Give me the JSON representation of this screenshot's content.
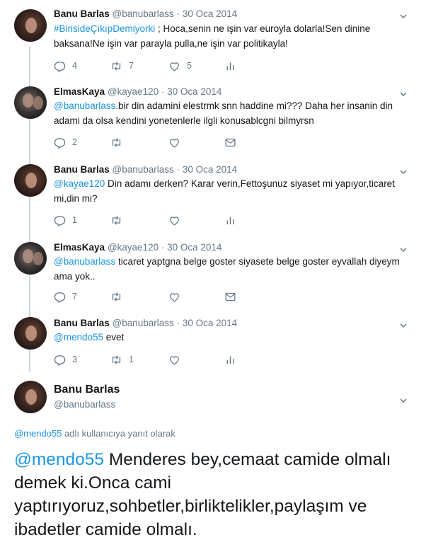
{
  "tweets": [
    {
      "name": "Banu Barlas",
      "handle": "@banubarlass",
      "date": "30 Oca 2014",
      "text_parts": [
        {
          "text": "#BirisideÇıkıpDemiyorki",
          "link": true
        },
        {
          "text": " ; Hoca,senin ne işin var euroyla dolarla!Sen dinine baksana!Ne işin var parayla pulla,ne işin var politikayla!",
          "link": false
        }
      ],
      "reply_count": "4",
      "retweet_count": "7",
      "like_count": "5",
      "last_icon": "analytics-icon"
    },
    {
      "name": "ElmasKaya",
      "handle": "@kayae120",
      "date": "30 Oca 2014",
      "text_parts": [
        {
          "text": "@banubarlass",
          "link": true
        },
        {
          "text": ".bir din adamini elestrmk snn haddine mi??? Daha her insanin din adami da olsa kendini yonetenlerle ilgli konusablcgni bilmyrsn",
          "link": false
        }
      ],
      "reply_count": "2",
      "retweet_count": "",
      "like_count": "",
      "last_icon": "message-icon"
    },
    {
      "name": "Banu Barlas",
      "handle": "@banubarlass",
      "date": "30 Oca 2014",
      "text_parts": [
        {
          "text": "@kayae120",
          "link": true
        },
        {
          "text": " Din adamı derken? Karar verin,Fettoşunuz siyaset mi yapıyor,ticaret mi,din mi?",
          "link": false
        }
      ],
      "reply_count": "1",
      "retweet_count": "",
      "like_count": "",
      "last_icon": "analytics-icon"
    },
    {
      "name": "ElmasKaya",
      "handle": "@kayae120",
      "date": "30 Oca 2014",
      "text_parts": [
        {
          "text": "@banubarlass",
          "link": true
        },
        {
          "text": " ticaret yaptgna belge goster siyasete belge goster eyvallah diyeym ama yok..",
          "link": false
        }
      ],
      "reply_count": "7",
      "retweet_count": "",
      "like_count": "",
      "last_icon": "message-icon"
    },
    {
      "name": "Banu Barlas",
      "handle": "@banubarlass",
      "date": "30 Oca 2014",
      "text_parts": [
        {
          "text": "@mendo55",
          "link": true
        },
        {
          "text": " evet",
          "link": false
        }
      ],
      "reply_count": "3",
      "retweet_count": "1",
      "like_count": "",
      "last_icon": "analytics-icon"
    }
  ],
  "main_tweet": {
    "name": "Banu Barlas",
    "handle": "@banubarlass",
    "replying_handle": "@mendo55",
    "replying_suffix": " adlı kullanıcıya yanıt olarak",
    "mention": "@mendo55",
    "text": " Menderes bey,cemaat camide olmalı demek ki.Onca cami yaptırıyoruz,sohbetler,birliktelikler,paylaşım ve ibadetler camide olmalı."
  },
  "colors": {
    "link": "#1b95e0",
    "muted": "#657786",
    "thread_line": "#ccd6dd",
    "text": "#14171a"
  }
}
